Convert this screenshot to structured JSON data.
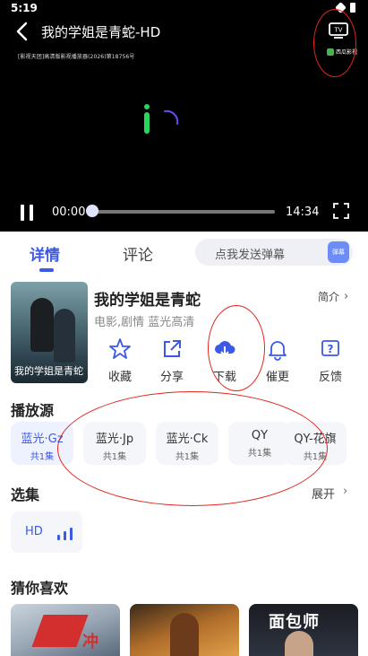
{
  "status_bar": {
    "time": "5:19"
  },
  "player": {
    "title": "我的学姐是青蛇-HD",
    "watermark": "[影视天团]高清版影视播放器(2026)第18756号",
    "logo_text": "西瓜影视",
    "current_time": "00:00",
    "total_time": "14:34",
    "progress": 0
  },
  "tabs": {
    "detail": "详情",
    "comments": "评论"
  },
  "danmaku": {
    "placeholder": "点我发送弹幕",
    "icon_text": "弹幕"
  },
  "movie": {
    "title": "我的学姐是青蛇",
    "intro_label": "简介",
    "genres": "电影,剧情 蓝光高清",
    "poster_text": "我的学姐是青蛇"
  },
  "actions": [
    {
      "label": "收藏",
      "icon": "star-icon"
    },
    {
      "label": "分享",
      "icon": "share-icon"
    },
    {
      "label": "下载",
      "icon": "download-cloud-icon"
    },
    {
      "label": "催更",
      "icon": "bell-icon"
    },
    {
      "label": "反馈",
      "icon": "feedback-icon"
    }
  ],
  "sources_section": {
    "title": "播放源",
    "items": [
      {
        "name": "蓝光·Gz",
        "count": "共1集",
        "selected": true
      },
      {
        "name": "蓝光·Jp",
        "count": "共1集",
        "selected": false
      },
      {
        "name": "蓝光·Ck",
        "count": "共1集",
        "selected": false
      },
      {
        "name": "QY",
        "count": "共1集",
        "selected": false
      },
      {
        "name": "QY-花旗",
        "count": "共1集",
        "selected": false
      }
    ]
  },
  "episodes_section": {
    "title": "选集",
    "expand_label": "展开",
    "episode": "HD"
  },
  "recommend_section": {
    "title": "猜你喜欢",
    "rec1_glyph": "冲",
    "rec3_title": "面包师"
  },
  "colors": {
    "accent": "#3a59e7",
    "annotation": "#e1261c"
  }
}
